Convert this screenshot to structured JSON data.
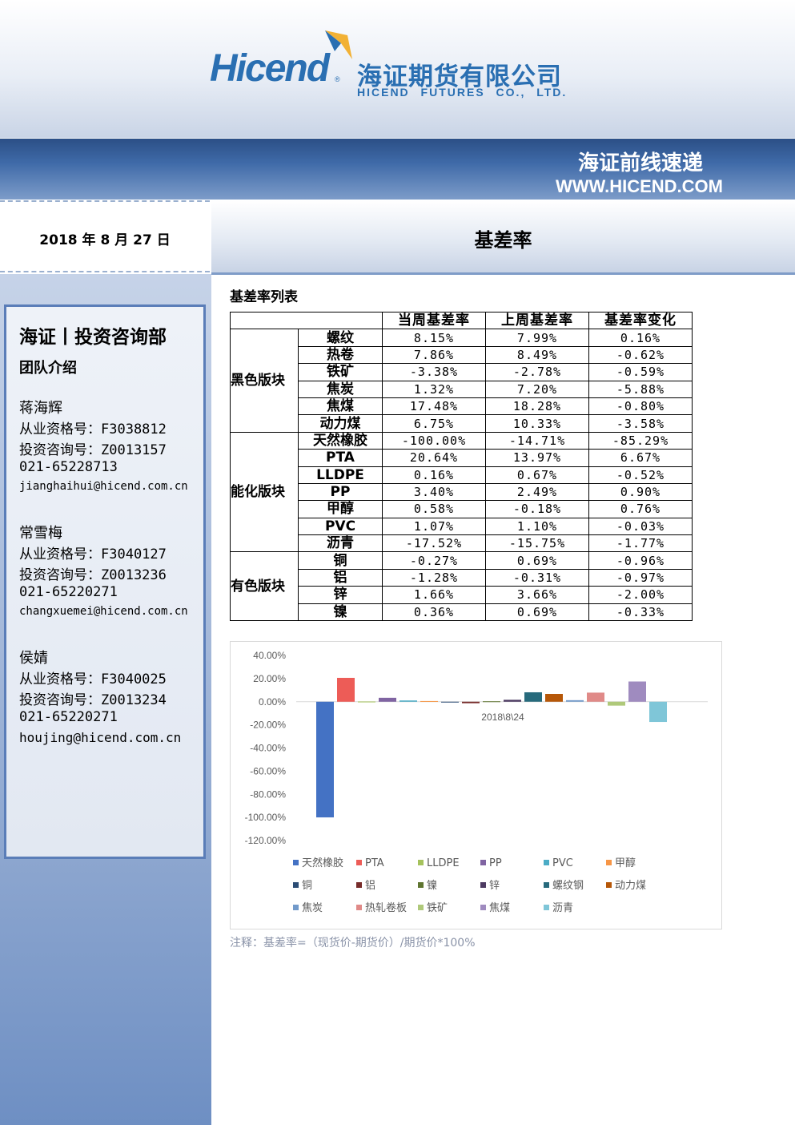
{
  "brand": {
    "logo_text": "Hicend",
    "reg_mark": "®",
    "name_cn": "海证期货有限公司",
    "name_en": "HICEND FUTURES CO., LTD."
  },
  "banner": {
    "title": "海证前线速递",
    "url": "WWW.HICEND.COM"
  },
  "report": {
    "date": "2018 年 8 月 27 日",
    "title": "基差率"
  },
  "sidebar": {
    "dept": "海证丨投资咨询部",
    "intro": "团队介绍",
    "members": [
      {
        "name": "蒋海辉",
        "qual": "从业资格号：F3038812",
        "invest": "投资咨询号：Z0013157",
        "phone": "021-65228713",
        "email": "jianghaihui@hicend.com.cn"
      },
      {
        "name": "常雪梅",
        "qual": "从业资格号：F3040127",
        "invest": "投资咨询号：Z0013236",
        "phone": "021-65220271",
        "email": "changxuemei@hicend.com.cn"
      },
      {
        "name": "侯婧",
        "qual": "从业资格号：F3040025",
        "invest": "投资咨询号：Z0013234",
        "phone": "021-65220271",
        "email": "houjing@hicend.com.cn"
      }
    ]
  },
  "table": {
    "title": "基差率列表",
    "headers": [
      "当周基差率",
      "上周基差率",
      "基差率变化"
    ],
    "groups": [
      {
        "name": "黑色版块",
        "rows": [
          [
            "螺纹",
            "8.15%",
            "7.99%",
            "0.16%"
          ],
          [
            "热卷",
            "7.86%",
            "8.49%",
            "-0.62%"
          ],
          [
            "铁矿",
            "-3.38%",
            "-2.78%",
            "-0.59%"
          ],
          [
            "焦炭",
            "1.32%",
            "7.20%",
            "-5.88%"
          ],
          [
            "焦煤",
            "17.48%",
            "18.28%",
            "-0.80%"
          ],
          [
            "动力煤",
            "6.75%",
            "10.33%",
            "-3.58%"
          ]
        ]
      },
      {
        "name": "能化版块",
        "rows": [
          [
            "天然橡胶",
            "-100.00%",
            "-14.71%",
            "-85.29%"
          ],
          [
            "PTA",
            "20.64%",
            "13.97%",
            "6.67%"
          ],
          [
            "LLDPE",
            "0.16%",
            "0.67%",
            "-0.52%"
          ],
          [
            "PP",
            "3.40%",
            "2.49%",
            "0.90%"
          ],
          [
            "甲醇",
            "0.58%",
            "-0.18%",
            "0.76%"
          ],
          [
            "PVC",
            "1.07%",
            "1.10%",
            "-0.03%"
          ],
          [
            "沥青",
            "-17.52%",
            "-15.75%",
            "-1.77%"
          ]
        ]
      },
      {
        "name": "有色版块",
        "rows": [
          [
            "铜",
            "-0.27%",
            "0.69%",
            "-0.96%"
          ],
          [
            "铝",
            "-1.28%",
            "-0.31%",
            "-0.97%"
          ],
          [
            "锌",
            "1.66%",
            "3.66%",
            "-2.00%"
          ],
          [
            "镍",
            "0.36%",
            "0.69%",
            "-0.33%"
          ]
        ]
      }
    ]
  },
  "chart_data": {
    "type": "bar",
    "categories": [
      "2018\\8\\24"
    ],
    "ylim": [
      -120,
      40
    ],
    "yticks": [
      "40.00%",
      "20.00%",
      "0.00%",
      "-20.00%",
      "-40.00%",
      "-60.00%",
      "-80.00%",
      "-100.00%",
      "-120.00%"
    ],
    "ytick_values": [
      40,
      20,
      0,
      -20,
      -40,
      -60,
      -80,
      -100,
      -120
    ],
    "legend_position": "bottom",
    "series": [
      {
        "name": "天然橡胶",
        "value": -100.0,
        "color": "#4472c4"
      },
      {
        "name": "PTA",
        "value": 20.64,
        "color": "#ed5c57"
      },
      {
        "name": "LLDPE",
        "value": 0.16,
        "color": "#a5c25c"
      },
      {
        "name": "PP",
        "value": 3.4,
        "color": "#8064a2"
      },
      {
        "name": "PVC",
        "value": 1.07,
        "color": "#4bacc6"
      },
      {
        "name": "甲醇",
        "value": 0.58,
        "color": "#f79646"
      },
      {
        "name": "铜",
        "value": -0.27,
        "color": "#2c4d75"
      },
      {
        "name": "铝",
        "value": -1.28,
        "color": "#772c2a"
      },
      {
        "name": "镍",
        "value": 0.36,
        "color": "#5f7530"
      },
      {
        "name": "锌",
        "value": 1.66,
        "color": "#4d3b62"
      },
      {
        "name": "螺纹钢",
        "value": 8.15,
        "color": "#276a7c"
      },
      {
        "name": "动力煤",
        "value": 6.75,
        "color": "#b65708"
      },
      {
        "name": "焦炭",
        "value": 1.32,
        "color": "#729aca"
      },
      {
        "name": "热轧卷板",
        "value": 7.86,
        "color": "#e08a88"
      },
      {
        "name": "铁矿",
        "value": -3.38,
        "color": "#afc97a"
      },
      {
        "name": "焦煤",
        "value": 17.48,
        "color": "#9f8bbf"
      },
      {
        "name": "沥青",
        "value": -17.52,
        "color": "#7fc6d8"
      }
    ]
  },
  "note": "注释：基差率=（现货价-期货价）/期货价*100%"
}
